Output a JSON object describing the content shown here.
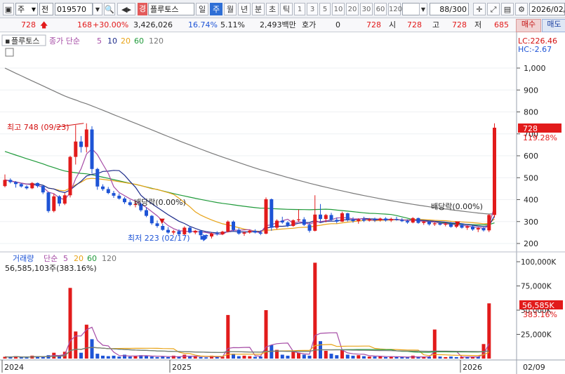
{
  "toolbar": {
    "market": "주",
    "view": "전",
    "code": "019570",
    "badge": "경",
    "name": "플루토스",
    "periods": [
      "일",
      "주",
      "월",
      "년",
      "분",
      "초",
      "틱"
    ],
    "minutes": [
      "1",
      "3",
      "5",
      "10",
      "20",
      "30",
      "60",
      "120"
    ],
    "count": "88",
    "count_total": "/300",
    "date": "2026/02/"
  },
  "quote": {
    "price": "728",
    "change": "168",
    "change_pct": "+30.00%",
    "volume": "3,426,026",
    "turnover_pct": "16.74%",
    "ratio": "5.11%",
    "amount": "2,493백만",
    "hoga_label": "호가",
    "hoga_value": "0",
    "ask_price": "728",
    "open_label": "시",
    "open": "728",
    "high_label": "고",
    "high": "728",
    "low_label": "저",
    "low": "685",
    "buy_label": "매수",
    "sell_label": "매도"
  },
  "price_panel": {
    "name": "플루토스",
    "legend_label": "종가 단순",
    "ma": [
      "5",
      "10",
      "20",
      "60",
      "120"
    ],
    "lc": "LC:226.46",
    "hc": "HC:-2.67",
    "annotations": {
      "high": "최고 748 (09/23)",
      "low": "최저 223 (02/17)",
      "dividend": "배당락(0.00%)"
    },
    "last_price": "728",
    "last_change": "119.28%"
  },
  "volume_panel": {
    "legend_label": "거래량",
    "legend_ma": "단순",
    "ma": [
      "5",
      "20",
      "60",
      "120"
    ],
    "summary": "56,585,103주(383.16%)",
    "last_volume": "56,585K",
    "last_change": "383.16%"
  },
  "x_axis": {
    "labels": [
      "2024",
      "2025",
      "2026"
    ],
    "right_label": "02/09"
  },
  "colors": {
    "up": "#e21b1b",
    "down": "#1e54d6",
    "ma5": "#a64ca6",
    "ma10": "#1c2b8a",
    "ma20": "#e8a317",
    "ma60": "#1f9a3a",
    "ma120": "#7a7a7a"
  },
  "chart_data": {
    "type": "candlestick",
    "price_axis": {
      "ticks": [
        200,
        300,
        400,
        500,
        600,
        700,
        800,
        900,
        1000
      ],
      "range": [
        170,
        1160
      ]
    },
    "volume_axis": {
      "ticks": [
        "25,000K",
        "50,000K",
        "75,000K",
        "100,000K"
      ],
      "range": [
        0,
        102000
      ]
    },
    "candles": [
      [
        462,
        515,
        456,
        490
      ],
      [
        490,
        497,
        474,
        480
      ],
      [
        480,
        485,
        455,
        471
      ],
      [
        471,
        476,
        455,
        460
      ],
      [
        460,
        466,
        446,
        452
      ],
      [
        452,
        480,
        448,
        476
      ],
      [
        476,
        478,
        455,
        462
      ],
      [
        462,
        467,
        425,
        433
      ],
      [
        433,
        435,
        340,
        348
      ],
      [
        348,
        428,
        342,
        415
      ],
      [
        415,
        420,
        370,
        382
      ],
      [
        382,
        430,
        375,
        420
      ],
      [
        420,
        600,
        410,
        595
      ],
      [
        595,
        740,
        560,
        665
      ],
      [
        665,
        690,
        615,
        640
      ],
      [
        640,
        748,
        615,
        720
      ],
      [
        720,
        735,
        520,
        540
      ],
      [
        540,
        545,
        445,
        460
      ],
      [
        460,
        470,
        440,
        448
      ],
      [
        448,
        458,
        425,
        430
      ],
      [
        430,
        440,
        408,
        418
      ],
      [
        418,
        428,
        400,
        405
      ],
      [
        405,
        412,
        380,
        388
      ],
      [
        388,
        398,
        370,
        376
      ],
      [
        376,
        392,
        365,
        380
      ],
      [
        380,
        386,
        345,
        352
      ],
      [
        352,
        365,
        320,
        326
      ],
      [
        326,
        330,
        285,
        292
      ],
      [
        292,
        305,
        272,
        280
      ],
      [
        280,
        290,
        258,
        262
      ],
      [
        262,
        275,
        245,
        250
      ],
      [
        250,
        262,
        240,
        256
      ],
      [
        256,
        265,
        236,
        242
      ],
      [
        242,
        278,
        238,
        272
      ],
      [
        272,
        280,
        246,
        250
      ],
      [
        250,
        262,
        242,
        258
      ],
      [
        258,
        262,
        232,
        238
      ],
      [
        238,
        242,
        226,
        232
      ],
      [
        232,
        250,
        223,
        246
      ],
      [
        246,
        256,
        236,
        242
      ],
      [
        242,
        258,
        238,
        254
      ],
      [
        254,
        305,
        250,
        300
      ],
      [
        300,
        305,
        255,
        262
      ],
      [
        262,
        270,
        240,
        245
      ],
      [
        245,
        255,
        235,
        250
      ],
      [
        250,
        262,
        245,
        258
      ],
      [
        258,
        265,
        246,
        250
      ],
      [
        250,
        260,
        238,
        245
      ],
      [
        245,
        410,
        242,
        402
      ],
      [
        402,
        405,
        258,
        272
      ],
      [
        272,
        310,
        264,
        304
      ],
      [
        304,
        322,
        290,
        296
      ],
      [
        296,
        302,
        275,
        280
      ],
      [
        280,
        310,
        276,
        306
      ],
      [
        306,
        355,
        300,
        310
      ],
      [
        310,
        320,
        280,
        285
      ],
      [
        285,
        295,
        250,
        258
      ],
      [
        258,
        420,
        255,
        332
      ],
      [
        332,
        380,
        300,
        312
      ],
      [
        312,
        335,
        296,
        330
      ],
      [
        330,
        340,
        300,
        308
      ],
      [
        308,
        318,
        292,
        300
      ],
      [
        300,
        345,
        298,
        338
      ],
      [
        338,
        340,
        300,
        310
      ],
      [
        310,
        320,
        295,
        302
      ],
      [
        302,
        315,
        290,
        310
      ],
      [
        310,
        322,
        298,
        304
      ],
      [
        304,
        316,
        300,
        310
      ],
      [
        310,
        318,
        298,
        306
      ],
      [
        306,
        318,
        300,
        314
      ],
      [
        314,
        320,
        300,
        305
      ],
      [
        305,
        318,
        298,
        312
      ],
      [
        312,
        322,
        304,
        308
      ],
      [
        308,
        316,
        298,
        302
      ],
      [
        302,
        310,
        290,
        296
      ],
      [
        296,
        320,
        292,
        316
      ],
      [
        316,
        318,
        290,
        294
      ],
      [
        294,
        302,
        285,
        300
      ],
      [
        300,
        304,
        282,
        288
      ],
      [
        288,
        296,
        280,
        292
      ],
      [
        292,
        300,
        282,
        286
      ],
      [
        286,
        296,
        278,
        290
      ],
      [
        290,
        298,
        272,
        276
      ],
      [
        276,
        290,
        270,
        285
      ],
      [
        285,
        292,
        268,
        272
      ],
      [
        272,
        282,
        262,
        278
      ],
      [
        278,
        282,
        258,
        264
      ],
      [
        264,
        275,
        252,
        270
      ],
      [
        270,
        278,
        255,
        260
      ],
      [
        260,
        334,
        252,
        330
      ],
      [
        330,
        748,
        318,
        728
      ]
    ],
    "volume": [
      [
        1800,
        1
      ],
      [
        1500,
        0
      ],
      [
        2500,
        1
      ],
      [
        1200,
        0
      ],
      [
        1000,
        0
      ],
      [
        3000,
        1
      ],
      [
        2000,
        0
      ],
      [
        1800,
        0
      ],
      [
        3500,
        0
      ],
      [
        6000,
        1
      ],
      [
        2500,
        0
      ],
      [
        7000,
        1
      ],
      [
        73000,
        1
      ],
      [
        28000,
        1
      ],
      [
        6000,
        0
      ],
      [
        35000,
        1
      ],
      [
        20000,
        0
      ],
      [
        5000,
        0
      ],
      [
        3000,
        0
      ],
      [
        2500,
        0
      ],
      [
        3000,
        0
      ],
      [
        2000,
        0
      ],
      [
        4000,
        0
      ],
      [
        2000,
        0
      ],
      [
        2500,
        1
      ],
      [
        3500,
        0
      ],
      [
        3000,
        0
      ],
      [
        2000,
        0
      ],
      [
        1500,
        0
      ],
      [
        2000,
        0
      ],
      [
        1500,
        0
      ],
      [
        3000,
        1
      ],
      [
        1800,
        0
      ],
      [
        4000,
        1
      ],
      [
        2000,
        0
      ],
      [
        2000,
        1
      ],
      [
        1500,
        0
      ],
      [
        1200,
        0
      ],
      [
        3000,
        1
      ],
      [
        1500,
        0
      ],
      [
        2000,
        1
      ],
      [
        45000,
        1
      ],
      [
        5000,
        0
      ],
      [
        2500,
        0
      ],
      [
        3000,
        1
      ],
      [
        2500,
        1
      ],
      [
        1800,
        0
      ],
      [
        2000,
        0
      ],
      [
        50000,
        1
      ],
      [
        14000,
        0
      ],
      [
        9000,
        1
      ],
      [
        4000,
        0
      ],
      [
        3000,
        0
      ],
      [
        7000,
        1
      ],
      [
        6000,
        1
      ],
      [
        4000,
        0
      ],
      [
        3000,
        0
      ],
      [
        99000,
        1
      ],
      [
        18000,
        0
      ],
      [
        8000,
        1
      ],
      [
        5000,
        0
      ],
      [
        3500,
        0
      ],
      [
        9000,
        1
      ],
      [
        4000,
        0
      ],
      [
        3000,
        0
      ],
      [
        3500,
        1
      ],
      [
        2500,
        0
      ],
      [
        2000,
        1
      ],
      [
        2000,
        0
      ],
      [
        2500,
        1
      ],
      [
        1500,
        0
      ],
      [
        2000,
        1
      ],
      [
        1500,
        0
      ],
      [
        1500,
        0
      ],
      [
        1200,
        0
      ],
      [
        3000,
        1
      ],
      [
        1500,
        0
      ],
      [
        1500,
        1
      ],
      [
        1800,
        0
      ],
      [
        30000,
        1
      ],
      [
        2000,
        0
      ],
      [
        1500,
        1
      ],
      [
        2000,
        0
      ],
      [
        1500,
        0
      ],
      [
        1800,
        1
      ],
      [
        1500,
        0
      ],
      [
        2000,
        1
      ],
      [
        1800,
        0
      ],
      [
        15000,
        1
      ],
      [
        57000,
        1
      ]
    ]
  }
}
